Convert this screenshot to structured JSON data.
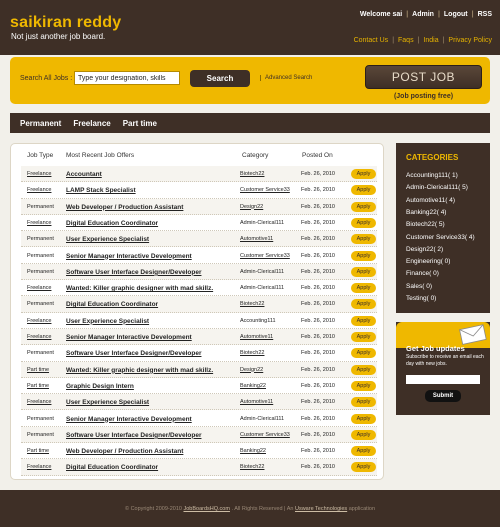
{
  "header": {
    "brand": "saikiran reddy",
    "tagline": "Not just another job board.",
    "user": {
      "welcome": "Welcome sai",
      "admin": "Admin",
      "logout": "Logout",
      "rss": "RSS"
    },
    "links": [
      "Contact Us",
      "Faqs",
      "India",
      "Privacy Policy"
    ]
  },
  "search": {
    "label": "Search All Jobs :",
    "input_value": "Type your designation, skills",
    "button": "Search",
    "advanced": "Advanced Search",
    "post_job": "POST JOB",
    "post_job_note": "(Job posting free)"
  },
  "nav": [
    "Permanent",
    "Freelance",
    "Part time"
  ],
  "table": {
    "headers": [
      "Job Type",
      "Most Recent Job Offers",
      "Category",
      "Posted On"
    ],
    "apply_label": "Apply",
    "rows": [
      {
        "type": "Freelance",
        "title": "Accountant",
        "category": "Biotech22",
        "date": "Feb. 26, 2010"
      },
      {
        "type": "Freelance",
        "title": "LAMP Stack Specialist",
        "category": "Customer Service33",
        "date": "Feb. 26, 2010"
      },
      {
        "type": "Permanent",
        "title": "Web Developer / Production Assistant",
        "category": "Design22",
        "date": "Feb. 26, 2010"
      },
      {
        "type": "Freelance",
        "title": "Digital Education Coordinator",
        "category": "Admin-Clerical111",
        "date": "Feb. 26, 2010"
      },
      {
        "type": "Permanent",
        "title": "User Experience Specialist",
        "category": "Automotive11",
        "date": "Feb. 26, 2010"
      },
      {
        "type": "Permanent",
        "title": "Senior Manager Interactive Development",
        "category": "Customer Service33",
        "date": "Feb. 26, 2010"
      },
      {
        "type": "Permanent",
        "title": "Software User Interface Designer/Developer",
        "category": "Admin-Clerical111",
        "date": "Feb. 26, 2010"
      },
      {
        "type": "Freelance",
        "title": "Wanted: Killer graphic designer with mad skillz.",
        "category": "Admin-Clerical111",
        "date": "Feb. 26, 2010"
      },
      {
        "type": "Permanent",
        "title": "Digital Education Coordinator",
        "category": "Biotech22",
        "date": "Feb. 26, 2010"
      },
      {
        "type": "Freelance",
        "title": "User Experience Specialist",
        "category": "Accounting111",
        "date": "Feb. 26, 2010"
      },
      {
        "type": "Freelance",
        "title": "Senior Manager Interactive Development",
        "category": "Automotive11",
        "date": "Feb. 26, 2010"
      },
      {
        "type": "Permanent",
        "title": "Software User Interface Designer/Developer",
        "category": "Biotech22",
        "date": "Feb. 26, 2010"
      },
      {
        "type": "Part time",
        "title": "Wanted: Killer graphic designer with mad skillz.",
        "category": "Design22",
        "date": "Feb. 26, 2010"
      },
      {
        "type": "Part time",
        "title": "Graphic Design Intern",
        "category": "Banking22",
        "date": "Feb. 26, 2010"
      },
      {
        "type": "Freelance",
        "title": "User Experience Specialist",
        "category": "Automotive11",
        "date": "Feb. 26, 2010"
      },
      {
        "type": "Permanent",
        "title": "Senior Manager Interactive Development",
        "category": "Admin-Clerical111",
        "date": "Feb. 26, 2010"
      },
      {
        "type": "Permanent",
        "title": "Software User Interface Designer/Developer",
        "category": "Customer Service33",
        "date": "Feb. 26, 2010"
      },
      {
        "type": "Part time",
        "title": "Web Developer / Production Assistant",
        "category": "Banking22",
        "date": "Feb. 26, 2010"
      },
      {
        "type": "Freelance",
        "title": "Digital Education Coordinator",
        "category": "Biotech22",
        "date": "Feb. 26, 2010"
      }
    ]
  },
  "categories": {
    "title": "CATEGORIES",
    "items": [
      "Accounting111( 1)",
      "Admin-Clerical111( 5)",
      "Automotive11( 4)",
      "Banking22( 4)",
      "Biotech22( 5)",
      "Customer Service33( 4)",
      "Design22( 2)",
      "Engineering( 0)",
      "Finance( 0)",
      "Sales( 0)",
      "Testing( 0)"
    ]
  },
  "job_updates": {
    "title": "Get Job updates",
    "text": "Subscribe to receive an email each day with new jobs.",
    "submit": "Submit"
  },
  "footer": {
    "copyright": "© Copyright 2009-2010",
    "site": "JobBoardsHQ.com",
    "rights": ". All Rights Reserved | An",
    "company": "Usware Technologies",
    "suffix": "application"
  },
  "colors": {
    "brown": "#3e2f26",
    "gold": "#efb800",
    "page_bg": "#f2f0ea"
  }
}
